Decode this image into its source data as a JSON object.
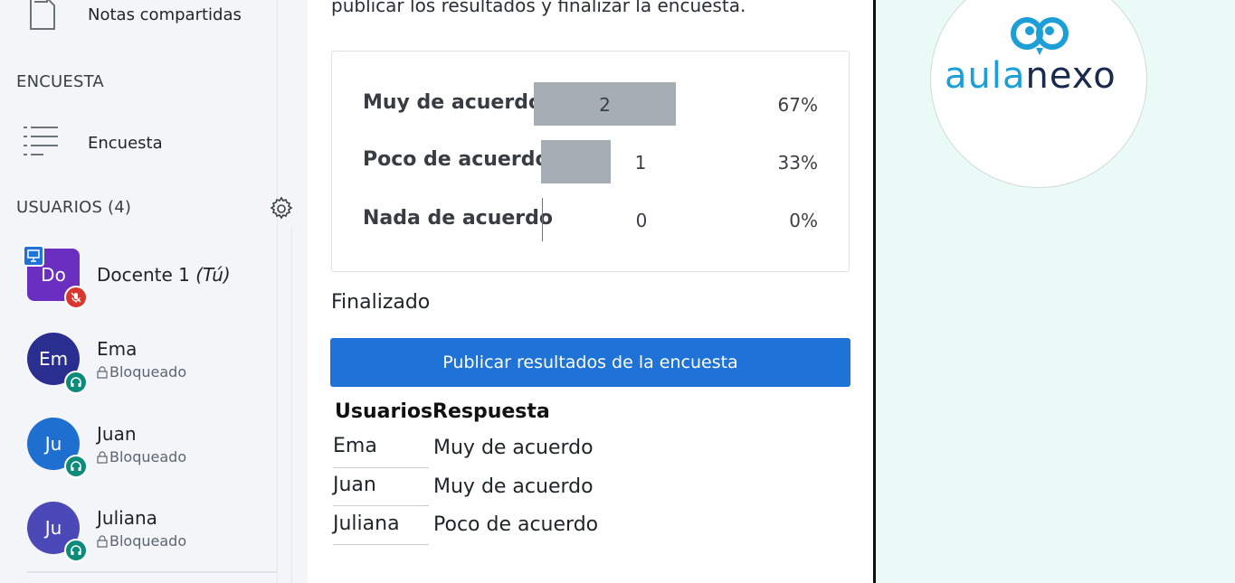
{
  "sidebar": {
    "shared_notes_label": "Notas compartidas",
    "poll_section_title": "ENCUESTA",
    "poll_item_label": "Encuesta",
    "users_section_title": "USUARIOS (4)",
    "users": [
      {
        "initials": "Do",
        "name": "Docente 1",
        "suffix": "(Tú)",
        "status": "",
        "color": "#6a2fc0"
      },
      {
        "initials": "Em",
        "name": "Ema",
        "status": "Bloqueado",
        "color": "#2a2f8f"
      },
      {
        "initials": "Ju",
        "name": "Juan",
        "status": "Bloqueado",
        "color": "#1f6fd0"
      },
      {
        "initials": "Ju",
        "name": "Juliana",
        "status": "Bloqueado",
        "color": "#4b49b8"
      }
    ]
  },
  "main": {
    "intro_text": "publicar los resultados y finalizar la encuesta.",
    "results": [
      {
        "label": "Muy de acuerdo",
        "count": "2",
        "percent": "67%",
        "fraction": 0.67
      },
      {
        "label": "Poco de acuerdo",
        "count": "1",
        "percent": "33%",
        "fraction": 0.33
      },
      {
        "label": "Nada de acuerdo",
        "count": "0",
        "percent": "0%",
        "fraction": 0
      }
    ],
    "status_label": "Finalizado",
    "publish_button_label": "Publicar resultados de la encuesta",
    "table": {
      "headers": [
        "Usuarios",
        "Respuesta"
      ],
      "rows": [
        {
          "user": "Ema",
          "answer": "Muy de acuerdo"
        },
        {
          "user": "Juan",
          "answer": "Muy de acuerdo"
        },
        {
          "user": "Juliana",
          "answer": "Poco de acuerdo"
        }
      ]
    }
  },
  "branding": {
    "logo_part1": "aula",
    "logo_part2": "nexo"
  },
  "colors": {
    "accent": "#1f73d6",
    "bar": "#a7adb4",
    "right_bg": "#eafaf6",
    "logo_blue": "#1b9fd6",
    "logo_dark": "#1a2a4f"
  }
}
